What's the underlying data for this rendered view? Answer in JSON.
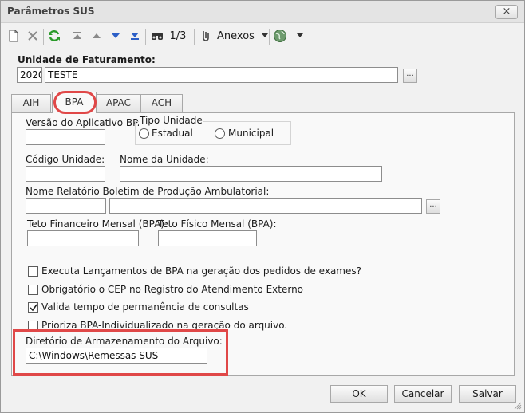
{
  "window": {
    "title": "Parâmetros SUS",
    "close_label": "×"
  },
  "toolbar": {
    "icons": [
      "new-document-icon",
      "delete-icon",
      "refresh-icon",
      "first-record-icon",
      "previous-record-icon",
      "next-record-icon",
      "last-record-icon",
      "find-icon",
      "attachments-icon",
      "globe-icon"
    ],
    "record_position": "1/3",
    "attachments_label": "Anexos"
  },
  "faturamento": {
    "label": "Unidade de Faturamento:",
    "code": "2020",
    "name": "TESTE",
    "browse_label": "..."
  },
  "tabs": [
    {
      "label": "AIH",
      "active": false
    },
    {
      "label": "BPA",
      "active": true
    },
    {
      "label": "APAC",
      "active": false
    },
    {
      "label": "ACH",
      "active": false
    }
  ],
  "bpa": {
    "versao_label": "Versão do Aplicativo BPA:",
    "versao_value": "",
    "tipo_unidade": {
      "legend": "Tipo Unidade",
      "options": [
        "Estadual",
        "Municipal"
      ],
      "selected": null
    },
    "codigo_unidade_label": "Código Unidade:",
    "codigo_unidade_value": "",
    "nome_unidade_label": "Nome da Unidade:",
    "nome_unidade_value": "",
    "relatorio_label": "Nome Relatório Boletim de Produção Ambulatorial:",
    "relatorio_code": "",
    "relatorio_name": "",
    "relatorio_browse_label": "...",
    "teto_financeiro_label": "Teto Financeiro Mensal (BPA):",
    "teto_financeiro_value": "",
    "teto_fisico_label": "Teto Físico Mensal (BPA):",
    "teto_fisico_value": "",
    "checkboxes": [
      {
        "label": "Executa Lançamentos de BPA na geração dos pedidos de exames?",
        "checked": false
      },
      {
        "label": "Obrigatório o CEP no Registro do Atendimento Externo",
        "checked": false
      },
      {
        "label": "Valida tempo de permanência de consultas",
        "checked": true
      },
      {
        "label": "Prioriza BPA-Individualizado na geração do arquivo.",
        "checked": false
      }
    ],
    "diretorio_label": "Diretório de Armazenamento do Arquivo:",
    "diretorio_value": "C:\\Windows\\Remessas SUS"
  },
  "footer": {
    "ok_label": "OK",
    "cancel_label": "Cancelar",
    "save_label": "Salvar"
  },
  "colors": {
    "highlight": "#e04848",
    "window_bg": "#f1f1f1",
    "panel_bg": "#f9f9f9",
    "refresh_icon": "#2a9a2a",
    "nav_arrow": "#2c5fc7"
  }
}
